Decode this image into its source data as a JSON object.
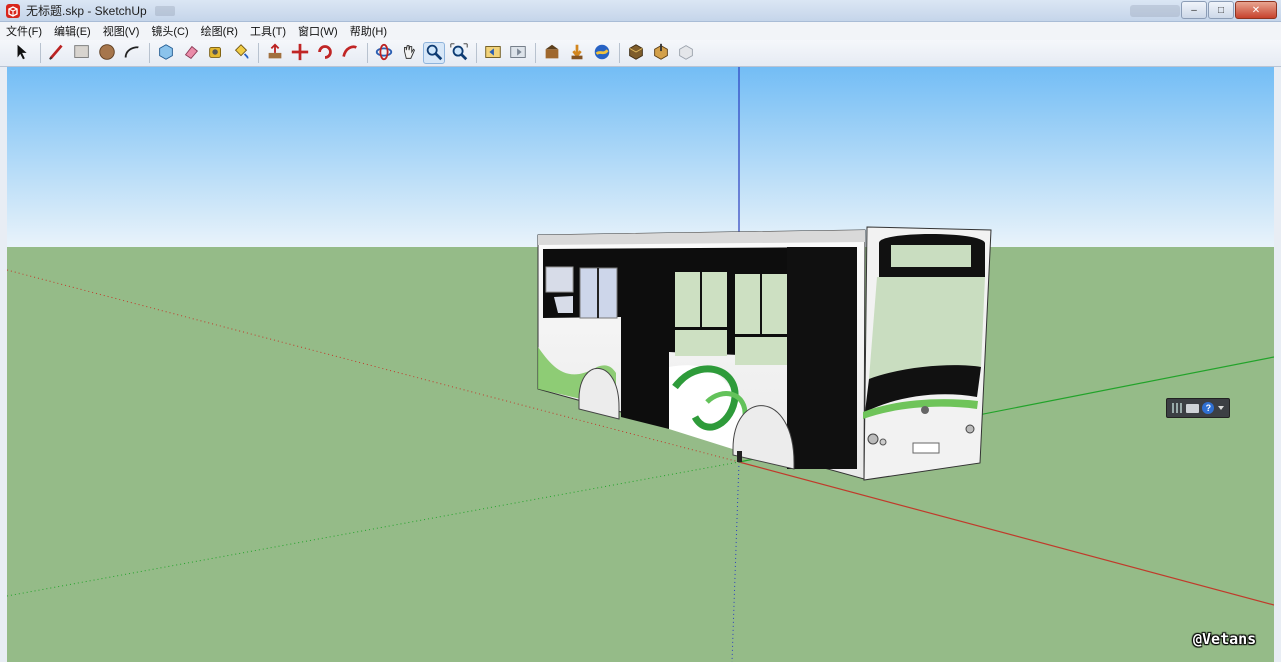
{
  "window": {
    "title": "无标题.skp - SketchUp",
    "controls": {
      "minimize": "–",
      "maximize": "□",
      "close": "✕"
    }
  },
  "menu": [
    "文件(F)",
    "编辑(E)",
    "视图(V)",
    "镜头(C)",
    "绘图(R)",
    "工具(T)",
    "窗口(W)",
    "帮助(H)"
  ],
  "toolbar": [
    {
      "icon": "select-arrow-icon",
      "active": false
    },
    {
      "sep": true
    },
    {
      "icon": "pencil-line-icon",
      "active": false
    },
    {
      "icon": "rectangle-icon",
      "active": false
    },
    {
      "icon": "circle-icon",
      "active": false
    },
    {
      "icon": "arc-icon",
      "active": false
    },
    {
      "sep": true
    },
    {
      "icon": "make-component-icon",
      "active": false
    },
    {
      "icon": "eraser-icon",
      "active": false
    },
    {
      "icon": "tape-measure-icon",
      "active": false
    },
    {
      "icon": "paint-bucket-icon",
      "active": false
    },
    {
      "sep": true
    },
    {
      "icon": "push-pull-icon",
      "active": false
    },
    {
      "icon": "move-icon",
      "active": false
    },
    {
      "icon": "rotate-icon",
      "active": false
    },
    {
      "icon": "follow-me-icon",
      "active": false
    },
    {
      "sep": true
    },
    {
      "icon": "orbit-icon",
      "active": false
    },
    {
      "icon": "pan-hand-icon",
      "active": false
    },
    {
      "icon": "zoom-icon",
      "active": true
    },
    {
      "icon": "zoom-extents-icon",
      "active": false
    },
    {
      "sep": true
    },
    {
      "icon": "previous-view-icon",
      "active": false
    },
    {
      "icon": "next-view-icon",
      "active": false
    },
    {
      "sep": true
    },
    {
      "icon": "warehouse-icon",
      "active": false
    },
    {
      "icon": "get-models-icon",
      "active": false
    },
    {
      "icon": "share-model-icon",
      "active": false
    },
    {
      "sep": true
    },
    {
      "icon": "extension-warehouse-icon",
      "active": false
    },
    {
      "icon": "layout-send-icon",
      "active": false
    },
    {
      "icon": "extension-manager-icon",
      "active": false
    }
  ],
  "nav_widget": {
    "help_label": "?"
  },
  "watermark": "@Vetans",
  "colors": {
    "sky_top": "#73bdf5",
    "sky_bottom": "#e9f3fa",
    "ground": "#95bb88",
    "axis_red": "#c03a2b",
    "axis_green": "#22a32a",
    "axis_blue": "#2b3fbf"
  }
}
